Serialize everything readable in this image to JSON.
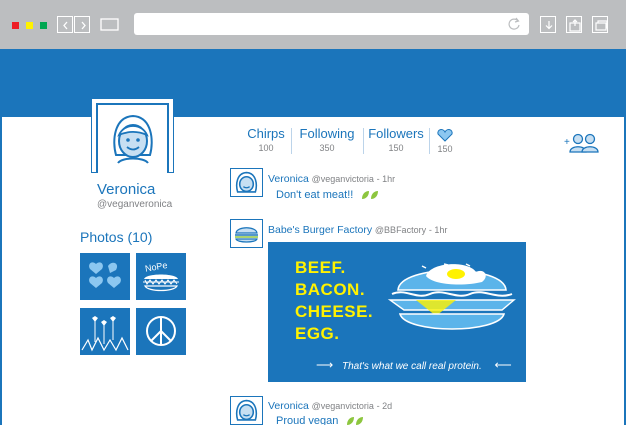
{
  "browser": {
    "controls": [
      "close",
      "minimize",
      "maximize"
    ],
    "colors": {
      "close": "#ed1c24",
      "minimize": "#fff200",
      "maximize": "#00a651"
    }
  },
  "profile": {
    "name": "Veronica",
    "handle": "@veganveronica"
  },
  "photos": {
    "title": "Photos (10)",
    "items": [
      {
        "icon": "hearts-icon"
      },
      {
        "icon": "nope-burger-icon",
        "text": "NoPe"
      },
      {
        "icon": "flowers-icon"
      },
      {
        "icon": "peace-icon"
      }
    ]
  },
  "stats": [
    {
      "label": "Chirps",
      "value": "100"
    },
    {
      "label": "Following",
      "value": "350"
    },
    {
      "label": "Followers",
      "value": "150"
    },
    {
      "icon": "heart-icon",
      "value": "150"
    }
  ],
  "feed": [
    {
      "author": "Veronica",
      "handle": "@veganvictoria",
      "time": "1hr",
      "text": "Don't eat meat!!"
    },
    {
      "author": "Babe's Burger Factory",
      "handle": "@BBFactory",
      "time": "1hr",
      "ad": {
        "lines": [
          "BEEF.",
          "BACON.",
          "CHEESE.",
          "EGG."
        ],
        "tagline": "That's what we call real protein."
      }
    },
    {
      "author": "Veronica",
      "handle": "@veganvictoria",
      "time": "2d",
      "text": "Proud vegan"
    }
  ],
  "colors": {
    "brand": "#1b75bb",
    "accent": "#fff200",
    "leaf": "#8dc63f"
  }
}
